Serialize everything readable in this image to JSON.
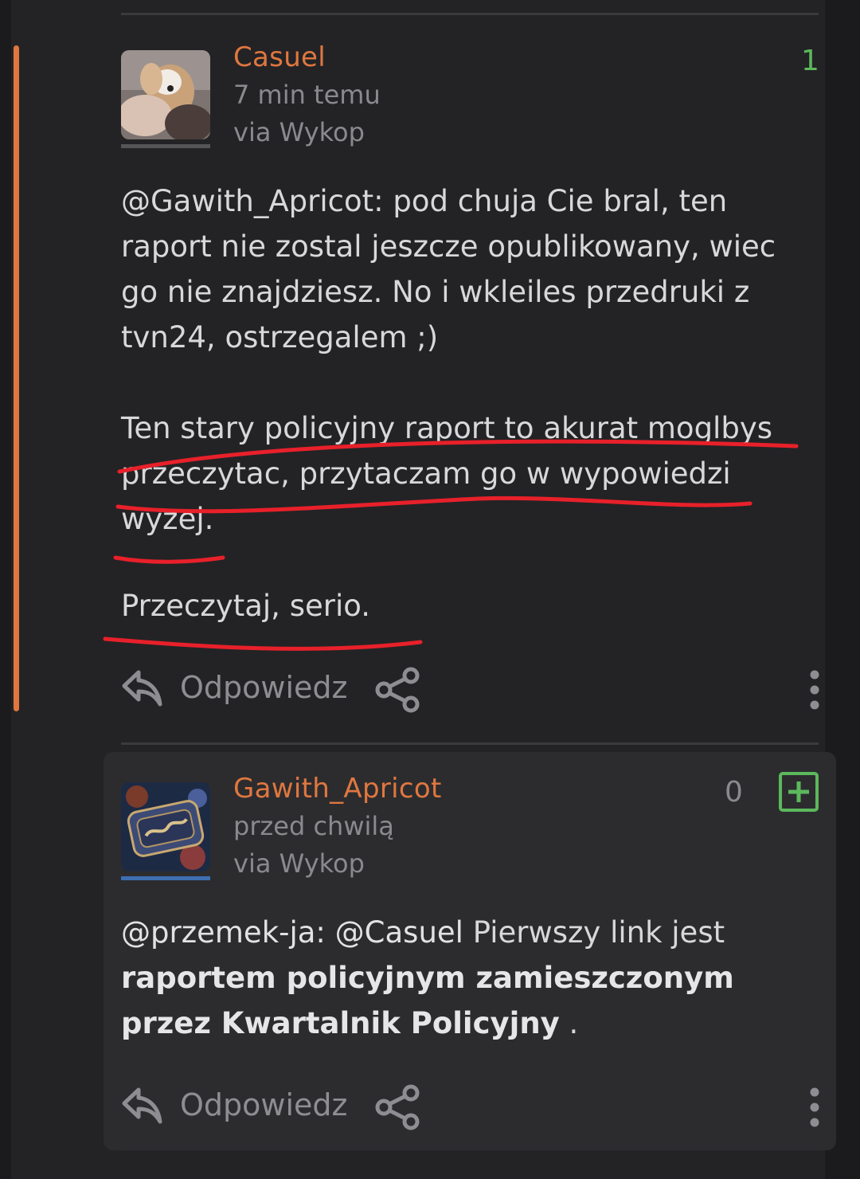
{
  "comment1": {
    "username": "Casuel",
    "time": "7 min temu",
    "via": "via Wykop",
    "votes": "1",
    "paragraphs": [
      "@Gawith_Apricot: pod chuja Cie bral, ten raport nie zostal jeszcze opublikowany, wiec go nie znajdziesz. No i wkleiles przedruki z tvn24, ostrzegalem ;)",
      "Ten stary policyjny raport to akurat moglbys przeczytac, przytaczam go w wypowiedzi wyzej.",
      "Przeczytaj, serio."
    ],
    "reply_label": "Odpowiedz"
  },
  "comment2": {
    "username": "Gawith_Apricot",
    "time": "przed chwilą",
    "via": "via Wykop",
    "votes": "0",
    "mention1": "@przemek-ja:",
    "mention2": "@Casuel",
    "text_plain": "Pierwszy link jest",
    "text_bold": "raportem policyjnym zamieszczonym przez Kwartalnik Policyjny",
    "text_end": " .",
    "reply_label": "Odpowiedz"
  },
  "icons": {
    "reply": "reply-arrow-icon",
    "share": "share-icon",
    "more": "more-vertical-icon",
    "plus": "plus-square-icon"
  },
  "colors": {
    "background": "#1b1b1d",
    "accent": "#e0773f",
    "vote_positive": "#5cb85c",
    "vote_zero": "#8a8a8e",
    "annotation_red": "#e8202a"
  }
}
